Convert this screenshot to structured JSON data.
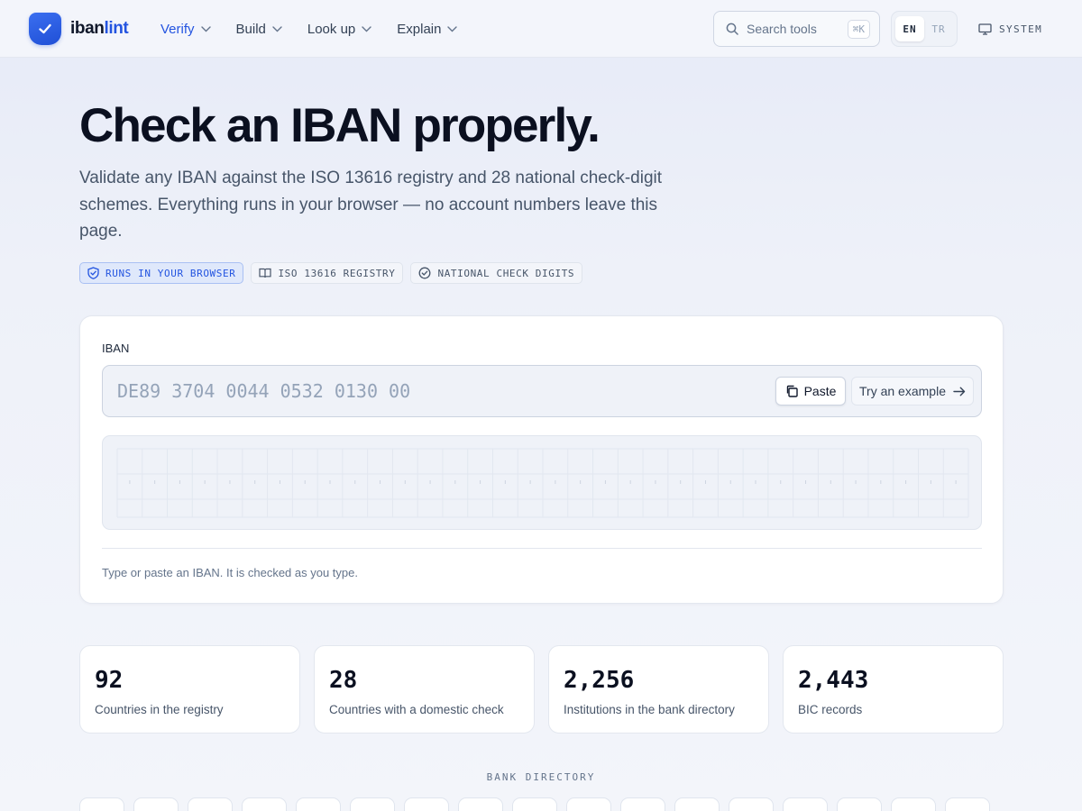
{
  "header": {
    "logo": {
      "prefix": "iban",
      "suffix": "lint"
    },
    "nav": [
      {
        "label": "Verify",
        "active": true
      },
      {
        "label": "Build",
        "active": false
      },
      {
        "label": "Look up",
        "active": false
      },
      {
        "label": "Explain",
        "active": false
      }
    ],
    "search": {
      "placeholder": "Search tools",
      "shortcut": "⌘K"
    },
    "languages": [
      {
        "code": "EN",
        "selected": true
      },
      {
        "code": "TR",
        "selected": false
      }
    ],
    "theme_label": "SYSTEM"
  },
  "hero": {
    "title": "Check an IBAN properly.",
    "subtitle": "Validate any IBAN against the ISO 13616 registry and 28 national check-digit schemes. Everything runs in your browser — no account numbers leave this page.",
    "badges": [
      {
        "label": "RUNS IN YOUR BROWSER",
        "icon": "shield-check-icon"
      },
      {
        "label": "ISO 13616 REGISTRY",
        "icon": "book-icon"
      },
      {
        "label": "NATIONAL CHECK DIGITS",
        "icon": "check-circle-icon"
      }
    ]
  },
  "checker": {
    "field_label": "IBAN",
    "input_value": "",
    "input_placeholder": "DE89 3704 0044 0532 0130 00",
    "paste_label": "Paste",
    "example_label": "Try an example",
    "hint": "Type or paste an IBAN. It is checked as you type."
  },
  "stats": [
    {
      "value": "92",
      "label": "Countries in the registry"
    },
    {
      "value": "28",
      "label": "Countries with a domestic check"
    },
    {
      "value": "2,256",
      "label": "Institutions in the bank directory"
    },
    {
      "value": "2,443",
      "label": "BIC records"
    }
  ],
  "bank_directory": {
    "section_label": "BANK DIRECTORY"
  },
  "colors": {
    "accent": "#2354e0",
    "text": "#0f172a",
    "muted": "#64748b",
    "badge_primary_bg": "#dfe8fb"
  }
}
